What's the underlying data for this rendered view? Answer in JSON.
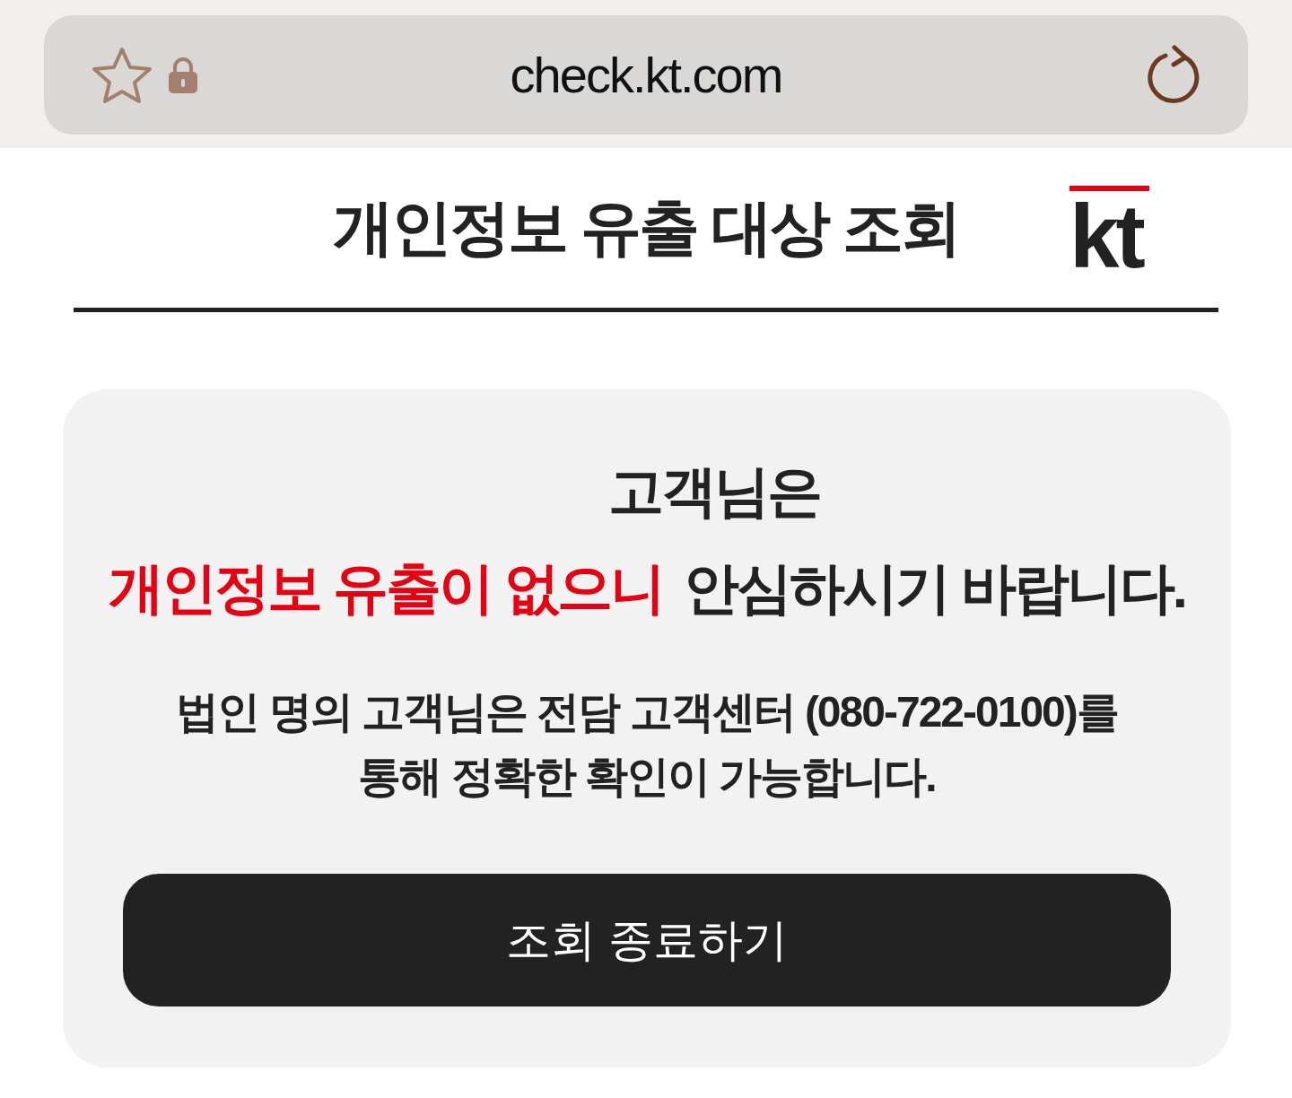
{
  "browser": {
    "url": "check.kt.com"
  },
  "header": {
    "title": "개인정보 유출 대상 조회",
    "logo": "kt"
  },
  "notice": {
    "greeting": "고객님은",
    "highlight": "개인정보 유출이 없으니",
    "message": "안심하시기 바랍니다.",
    "detail": "법인 명의 고객님은 전담 고객센터 (080-722-0100)를 통해 정확한 확인이 가능합니다."
  },
  "button": {
    "label": "조회 종료하기"
  }
}
